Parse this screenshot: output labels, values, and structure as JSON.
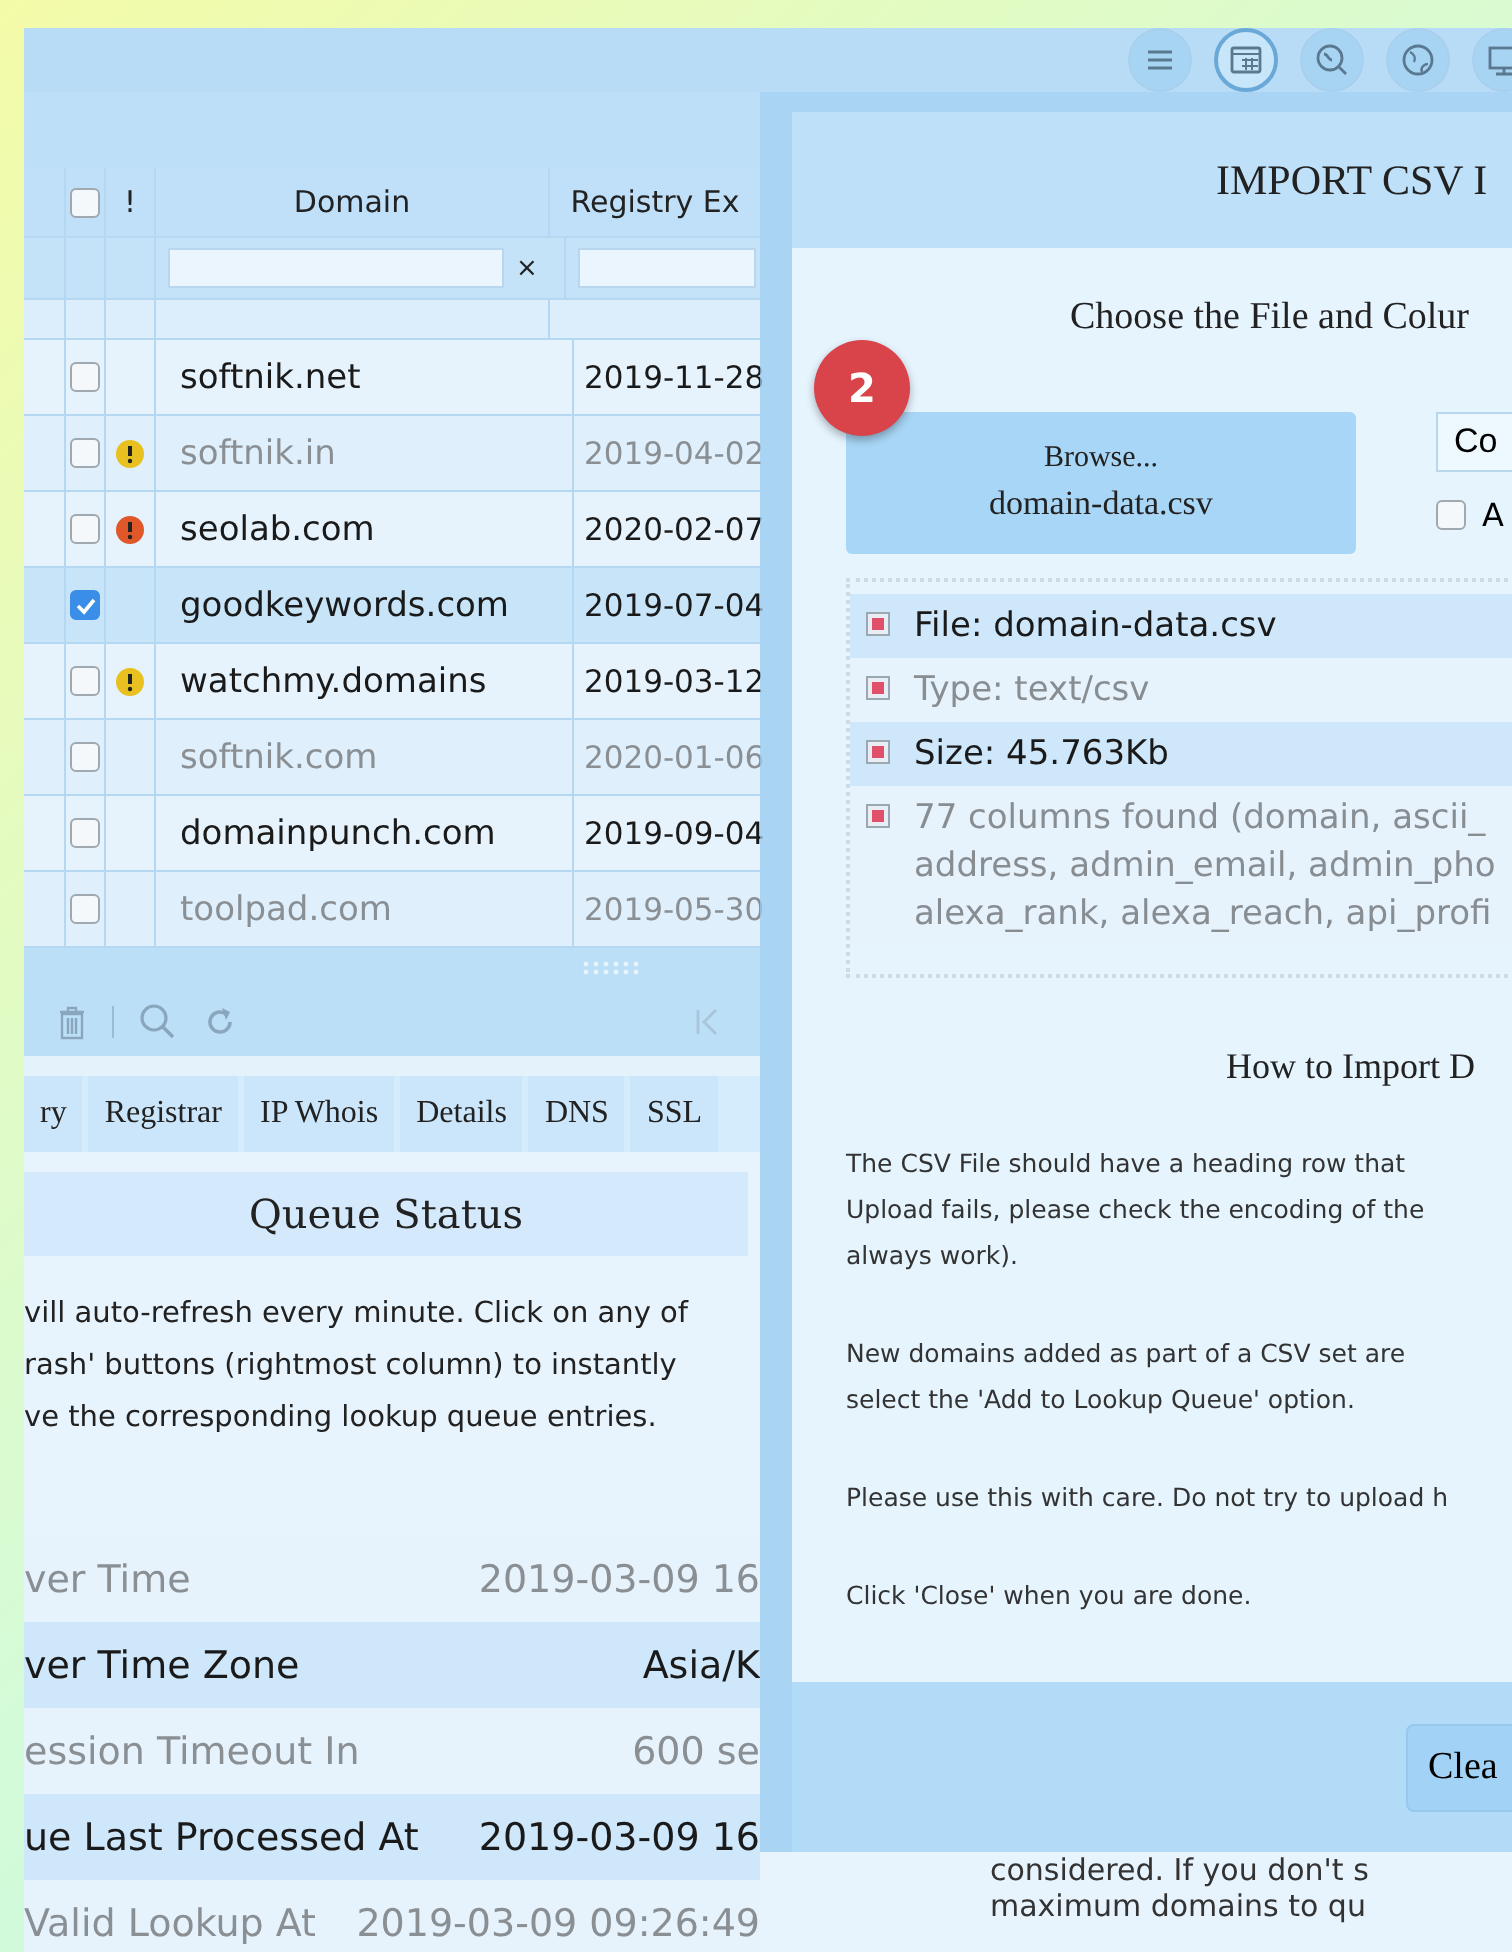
{
  "toolbar": {
    "icons": [
      {
        "kind": "menu",
        "selected": false
      },
      {
        "kind": "calendar",
        "selected": true
      },
      {
        "kind": "globe-search",
        "selected": false
      },
      {
        "kind": "globe",
        "selected": false
      },
      {
        "kind": "monitor",
        "selected": false
      }
    ]
  },
  "table": {
    "columns": [
      "",
      "!",
      "Domain",
      "Registry Ex"
    ],
    "all_checked": false,
    "filter_clear": "×",
    "rows": [
      {
        "domain": "softnik.net",
        "date": "2019-11-28",
        "kind": "none",
        "checked": false,
        "selected": false,
        "dimmed": false
      },
      {
        "domain": "softnik.in",
        "date": "2019-04-02",
        "kind": "warning",
        "checked": false,
        "selected": false,
        "dimmed": true
      },
      {
        "domain": "seolab.com",
        "date": "2020-02-07",
        "kind": "error",
        "checked": false,
        "selected": false,
        "dimmed": false
      },
      {
        "domain": "goodkeywords.com",
        "date": "2019-07-04",
        "kind": "none",
        "checked": true,
        "selected": true,
        "dimmed": false
      },
      {
        "domain": "watchmy.domains",
        "date": "2019-03-12",
        "kind": "warning",
        "checked": false,
        "selected": false,
        "dimmed": false
      },
      {
        "domain": "softnik.com",
        "date": "2020-01-06",
        "kind": "none",
        "checked": false,
        "selected": false,
        "dimmed": true
      },
      {
        "domain": "domainpunch.com",
        "date": "2019-09-04",
        "kind": "none",
        "checked": false,
        "selected": false,
        "dimmed": false
      },
      {
        "domain": "toolpad.com",
        "date": "2019-05-30",
        "kind": "none",
        "checked": false,
        "selected": false,
        "dimmed": true
      }
    ]
  },
  "tabs": [
    {
      "label": "ry",
      "selected": false
    },
    {
      "label": "Registrar",
      "selected": false
    },
    {
      "label": "IP Whois",
      "selected": false
    },
    {
      "label": "Details",
      "selected": false
    },
    {
      "label": "DNS",
      "selected": false
    },
    {
      "label": "SSL",
      "selected": false
    }
  ],
  "queue": {
    "title": "Queue Status",
    "lines": [
      "vill auto-refresh every minute. Click on any of",
      "rash' buttons (rightmost column) to instantly",
      "ve the corresponding lookup queue entries."
    ],
    "rows": [
      {
        "label": "ver Time",
        "value": "2019-03-09 16"
      },
      {
        "label": "ver Time Zone",
        "value": "Asia/K"
      },
      {
        "label": "ession Timeout In",
        "value": "600 se"
      },
      {
        "label": "ue Last Processed At",
        "value": "2019-03-09 16"
      },
      {
        "label": "Valid Lookup At",
        "value": "2019-03-09 09:26:49"
      }
    ]
  },
  "dialog": {
    "title": "IMPORT CSV I",
    "subtitle": "Choose the File and Colur",
    "badge": "2",
    "browse_label": "Browse...",
    "file_name": "domain-data.csv",
    "column_button": "Co",
    "checkbox_label": "A",
    "checkbox_checked": false,
    "file_info": [
      "File: domain-data.csv",
      "Type: text/csv",
      "Size: 45.763Kb",
      "77 columns found (domain, ascii_\naddress, admin_email, admin_pho\nalexa_rank, alexa_reach, api_profi"
    ],
    "help_title": "How to Import D",
    "help": [
      "The CSV File should have a heading row that \nUpload fails, please check the encoding of the\nalways work).",
      "New domains added as part of a CSV set are\nselect the 'Add to Lookup Queue' option.",
      "Please use this with care. Do not try to upload h",
      "Click 'Close' when you are done."
    ],
    "footer_button": "Clea"
  },
  "below_dialog": [
    "considered. If you don't s",
    "maximum domains to qu"
  ]
}
